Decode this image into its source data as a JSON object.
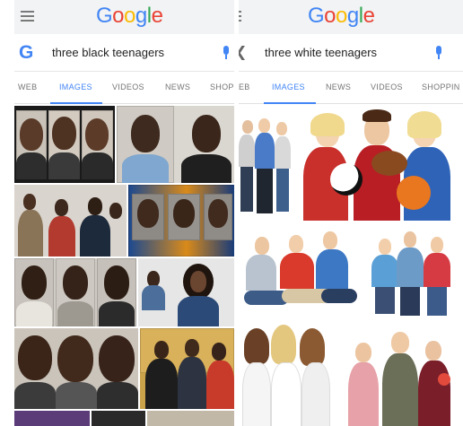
{
  "left_screen": {
    "logo": {
      "letters": [
        "G",
        "o",
        "o",
        "g",
        "l",
        "e"
      ]
    },
    "search": {
      "query": "three black teenagers",
      "leading_icon": "google-g-icon",
      "trailing_icon": "microphone-icon"
    },
    "tabs": [
      "WEB",
      "IMAGES",
      "VIDEOS",
      "NEWS",
      "SHOPI"
    ],
    "active_tab": "IMAGES"
  },
  "right_screen": {
    "logo": {
      "letters": [
        "G",
        "o",
        "o",
        "g",
        "l",
        "e"
      ]
    },
    "search": {
      "query": "three white teenagers",
      "leading_icon": "back-arrow-icon",
      "trailing_icon": "microphone-icon"
    },
    "tabs": [
      "EB",
      "IMAGES",
      "NEWS",
      "VIDEOS",
      "SHOPPIN"
    ],
    "active_tab": "IMAGES"
  },
  "colors": {
    "google_blue": "#4285f4",
    "google_red": "#ea4335",
    "google_yellow": "#fbbc05",
    "google_green": "#34a853",
    "top_bar": "#f1f3f4"
  }
}
